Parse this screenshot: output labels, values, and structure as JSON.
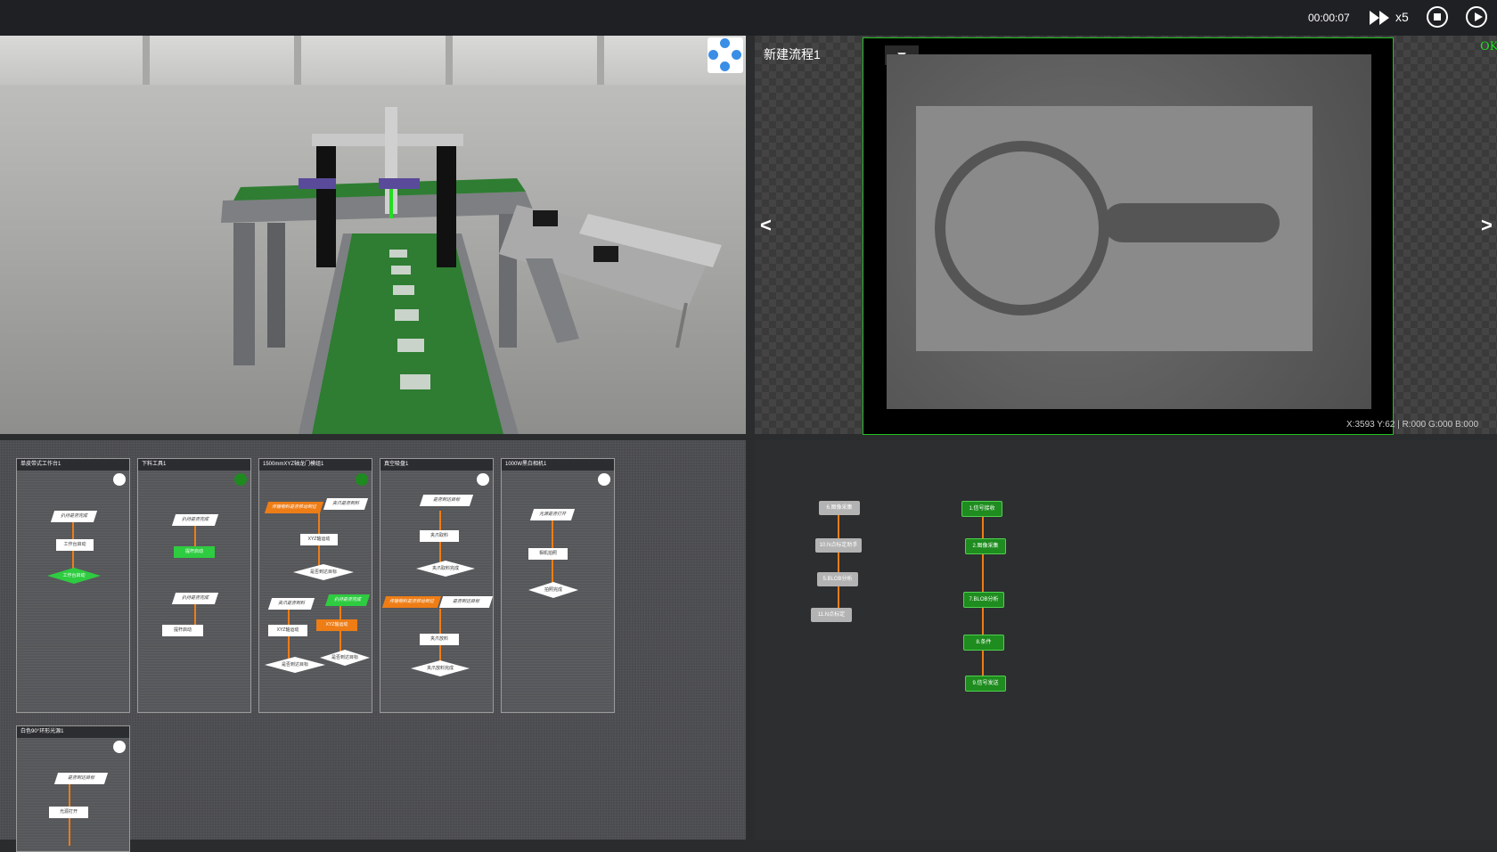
{
  "toolbar": {
    "timer": "00:00:07",
    "speed": "x5",
    "fast_forward_icon": "fast-forward-icon",
    "stop_icon": "stop-icon",
    "play_icon": "play-icon"
  },
  "vision": {
    "title": "新建流程1",
    "status": "OK",
    "prev": "<",
    "next": ">",
    "coords": "X:3593  Y:62  |  R:000  G:000  B:000"
  },
  "workflow": {
    "cards": [
      {
        "title": "单皮带式工作台1",
        "status_color": "#ffffff",
        "nodes": [
          "扒持是否完成",
          "工作台启动",
          "工作台启动"
        ]
      },
      {
        "title": "下料工具1",
        "status_color": "#1f8a1f",
        "nodes": [
          "扒持是否完成",
          "提杆启动",
          "扒持是否完成",
          "提杆启动"
        ]
      },
      {
        "title": "1500mmXYZ轴龙门模组1",
        "status_color": "#1f8a1f",
        "nodes": [
          "传输物料是否移动到位",
          "夹爪是否到料",
          "XYZ轴运动",
          "是否到达目标",
          "夹爪是否到料",
          "扒持是否完成",
          "XYZ轴运动",
          "XYZ轴运动",
          "是否到达目标",
          "是否到达目标"
        ]
      },
      {
        "title": "真空吸盘1",
        "status_color": "#ffffff",
        "nodes": [
          "是否到达目标",
          "夹爪取料",
          "夹爪取料完成",
          "传输物料是否移动到位",
          "是否到达目标",
          "夹爪放料",
          "夹爪放料完成"
        ]
      },
      {
        "title": "1000W黑白相机1",
        "status_color": "#ffffff",
        "nodes": [
          "光源是否打开",
          "相机拍照",
          "拍照完成"
        ]
      },
      {
        "title": "白色90°环形光源1",
        "status_color": "#ffffff",
        "nodes": [
          "是否到达目标",
          "光源打开"
        ]
      }
    ]
  },
  "flowgraph": {
    "left": [
      "6.图像采集",
      "10.N点标定助手",
      "5.BLOB分析",
      "11.N点标定"
    ],
    "right": [
      "1.信号接收",
      "2.图像采集",
      "7.BLOB分析",
      "8.条件",
      "9.信号发送"
    ]
  }
}
